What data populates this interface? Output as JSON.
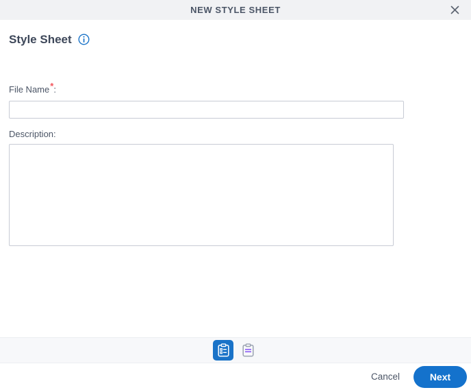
{
  "window": {
    "title": "NEW STYLE SHEET",
    "close_icon": "close-icon"
  },
  "form": {
    "section_title": "Style Sheet",
    "info_icon": "info-icon",
    "file_name": {
      "label": "File Name",
      "required_marker": "*",
      "colon": ":",
      "value": "",
      "placeholder": ""
    },
    "description": {
      "label": "Description:",
      "value": "",
      "placeholder": ""
    }
  },
  "steps": [
    {
      "name": "style-sheet-step",
      "icon": "clipboard-list-icon",
      "state": "active"
    },
    {
      "name": "content-step",
      "icon": "clipboard-lines-icon",
      "state": "inactive"
    }
  ],
  "footer": {
    "cancel_label": "Cancel",
    "next_label": "Next"
  },
  "colors": {
    "accent": "#1472cc",
    "step_active": "#1a73c8",
    "required": "#f2545b",
    "title_bar": "#f1f2f4",
    "steps_bar": "#f7f8fa",
    "text": "#3d4759",
    "border": "#c7cbd4",
    "step_inactive_icon": "#9aa2b1",
    "step_inactive_lines": "#8b5cf6"
  }
}
